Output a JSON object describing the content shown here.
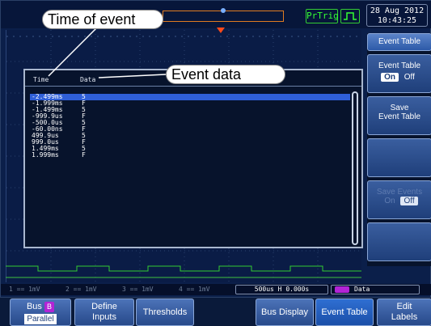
{
  "top_bar": {
    "trigger_mode": "PrTrig",
    "date": "28 Aug 2012",
    "time": "10:43:25"
  },
  "callouts": {
    "time_of_event": "Time of event",
    "event_data": "Event data"
  },
  "event_table": {
    "headers": {
      "time": "Time",
      "data": "Data"
    },
    "rows": [
      {
        "time": "-2.499ms",
        "data": "5"
      },
      {
        "time": "-1.999ms",
        "data": "F"
      },
      {
        "time": "-1.499ms",
        "data": "5"
      },
      {
        "time": "-999.9us",
        "data": "F"
      },
      {
        "time": "-500.0us",
        "data": "5"
      },
      {
        "time": "-60.00ns",
        "data": "F"
      },
      {
        "time": "499.9us",
        "data": "5"
      },
      {
        "time": "999.0us",
        "data": "F"
      },
      {
        "time": "1.499ms",
        "data": "5"
      },
      {
        "time": "1.999ms",
        "data": "F"
      }
    ],
    "selected_index": 0
  },
  "side_menu": {
    "title": "Event Table",
    "event_table_label": "Event Table",
    "on": "On",
    "off": "Off",
    "save_label_1": "Save",
    "save_label_2": "Event Table",
    "save_events_label_1": "Save Events",
    "save_events_on": "On",
    "save_events_off": "Off"
  },
  "status_bar": {
    "ch1": "1  ==  1mV",
    "ch2": "2  ==  1mV",
    "ch3": "3  ==  1mV",
    "ch4": "4  ==  1mV",
    "timebase": "500us  H  0.000s",
    "bus_label": "Data"
  },
  "bottom_menu": {
    "bus": "Bus",
    "bus_badge": "B",
    "bus_type": "Parallel",
    "define_1": "Define",
    "define_2": "Inputs",
    "thresholds": "Thresholds",
    "bus_display": "Bus Display",
    "event_table": "Event Table",
    "edit_1": "Edit",
    "edit_2": "Labels"
  },
  "colors": {
    "background": "#0b1f4a",
    "accent_orange": "#e07c21",
    "trigger_green": "#33ff33",
    "bus_purple": "#b224d6",
    "selection_blue": "#2f5fd8"
  }
}
